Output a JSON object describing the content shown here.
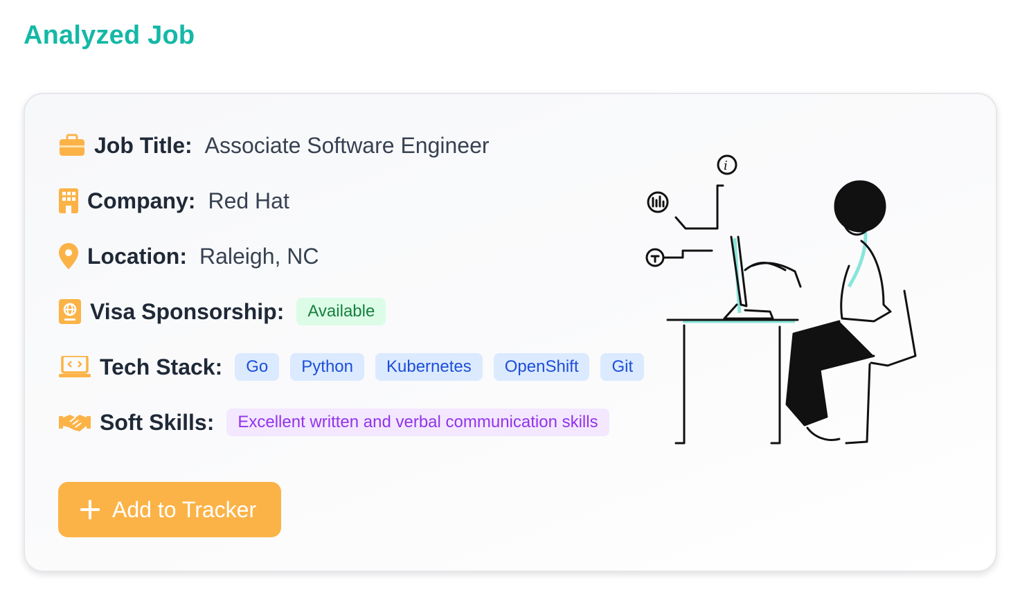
{
  "page": {
    "title": "Analyzed Job"
  },
  "job": {
    "title_label": "Job Title:",
    "title_value": "Associate Software Engineer",
    "company_label": "Company:",
    "company_value": "Red Hat",
    "location_label": "Location:",
    "location_value": "Raleigh, NC",
    "visa_label": "Visa Sponsorship:",
    "visa_value": "Available",
    "tech_label": "Tech Stack:",
    "tech_stack": [
      "Go",
      "Python",
      "Kubernetes",
      "OpenShift",
      "Git"
    ],
    "soft_label": "Soft Skills:",
    "soft_skills": [
      "Excellent written and verbal communication skills"
    ]
  },
  "actions": {
    "add_to_tracker": "Add to Tracker"
  },
  "icons": {
    "job_title": "briefcase-icon",
    "company": "building-icon",
    "location": "map-pin-icon",
    "visa": "passport-icon",
    "tech": "laptop-code-icon",
    "soft": "handshake-icon",
    "add": "plus-icon"
  },
  "colors": {
    "accent": "#14b8a6",
    "icon": "#fbb347",
    "button": "#fbb347",
    "badge_green_bg": "#dcfce7",
    "badge_green_text": "#15803d",
    "badge_blue_bg": "#dbeafe",
    "badge_blue_text": "#1d4ed8",
    "badge_purple_bg": "#f3e8ff",
    "badge_purple_text": "#9333ea"
  }
}
